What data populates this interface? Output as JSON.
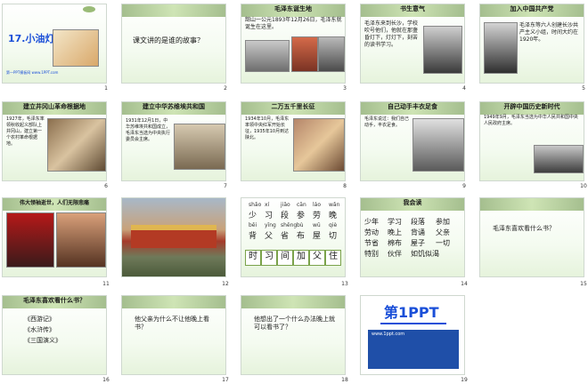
{
  "slides": [
    {
      "n": "1",
      "title": "17.小油灯",
      "footer": "第一PPT模板网 www.1PPT.com"
    },
    {
      "n": "2",
      "text": "课文讲的是谁的故事？"
    },
    {
      "n": "3",
      "title": "毛泽东诞生地",
      "text": "韶山一公元1893年12月26日，毛泽东就诞生在这里。"
    },
    {
      "n": "4",
      "title": "书生意气",
      "text": "毛泽东来到长沙，学校吹号他们，他就在那盏昏灯下，灯灯下，刻苦的读书学习。"
    },
    {
      "n": "5",
      "title": "加入中国共产党",
      "text": "毛泽东等六人创建长沙共产主义小组，时间大约在1920年。"
    },
    {
      "n": "6",
      "title": "建立井冈山革命根据地",
      "text": "1927年，毛泽东率领秋收起义部队上井冈山，建立第一个农村革命根据地。"
    },
    {
      "n": "7",
      "title": "建立中华苏维埃共和国",
      "text": "1931年12月1日，中华苏维埃共和国成立，毛泽东当选为中央执行委员会主席。"
    },
    {
      "n": "8",
      "title": "二万五千里长征",
      "text": "1934年10月，毛泽东率领中央红军开始长征，1935年10月到达陕北。"
    },
    {
      "n": "9",
      "title": "自己动手丰衣足食",
      "text": "毛泽东说过：我们自己动手，丰衣足食。"
    },
    {
      "n": "10",
      "title": "开辟中国历史新时代",
      "text": "1949年9月，毛泽东当选为中华人民共和国中央人民政府主席。"
    },
    {
      "n": "11",
      "title": "伟大领袖逝世，人们无限悲痛"
    },
    {
      "n": "12"
    },
    {
      "n": "13",
      "pinyin": [
        "shǎo",
        "xí",
        "jiǎo",
        "cān",
        "láo",
        "wǎn",
        "bēi",
        "yīng",
        "shěng",
        "bù",
        "wū",
        "qiè"
      ],
      "chars_top": [
        "少",
        "习",
        "段",
        "参",
        "劳",
        "晚"
      ],
      "chars_mid": [
        "背",
        "父",
        "省",
        "布",
        "屋",
        "切"
      ],
      "boxes": [
        "时",
        "习",
        "间",
        "加",
        "父",
        "住"
      ]
    },
    {
      "n": "14",
      "title": "我会读",
      "words": [
        [
          "少年",
          "学习",
          "段落",
          "参加"
        ],
        [
          "劳动",
          "晚上",
          "背诵",
          "父亲"
        ],
        [
          "节省",
          "棉布",
          "屋子",
          "一切"
        ],
        [
          "特别",
          "伙伴",
          "如饥似渴"
        ]
      ]
    },
    {
      "n": "15",
      "text": "毛泽东喜欢看什么书？"
    },
    {
      "n": "16",
      "title": "毛泽东喜欢看什么书？",
      "books": [
        "《西游记》",
        "《水浒传》",
        "《三国演义》"
      ]
    },
    {
      "n": "17",
      "text": "他父亲为什么不让他晚上看书？"
    },
    {
      "n": "18",
      "text": "他想出了一个什么办法晚上就可以看书了？"
    },
    {
      "n": "19",
      "logo": "第1PPT",
      "sub": "www.1ppt.com"
    }
  ],
  "colors": {
    "accent": "#5c8a34",
    "blue": "#1a4fd8",
    "red": "#c01d1d"
  }
}
